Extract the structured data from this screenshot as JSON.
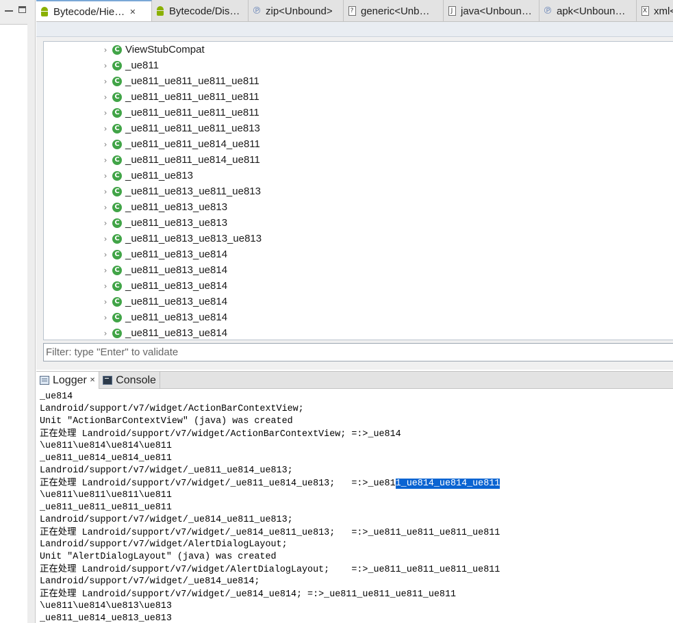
{
  "editor_tabs": [
    {
      "label": "Bytecode/Hie…",
      "icon": "android-icon",
      "active": true,
      "closable": true
    },
    {
      "label": "Bytecode/Dis…",
      "icon": "android-icon",
      "active": false,
      "closable": false
    },
    {
      "label": "zip<Unbound>",
      "icon": "p-icon",
      "active": false,
      "closable": false
    },
    {
      "label": "generic<Unb…",
      "icon": "doc-question-icon",
      "active": false,
      "closable": false
    },
    {
      "label": "java<Unboun…",
      "icon": "doc-j-icon",
      "active": false,
      "closable": false
    },
    {
      "label": "apk<Unboun…",
      "icon": "p-icon",
      "active": false,
      "closable": false
    },
    {
      "label": "xml<",
      "icon": "doc-x-icon",
      "active": false,
      "closable": false
    }
  ],
  "tree_items": [
    "ViewStubCompat",
    "_ue811",
    "_ue811_ue811_ue811_ue811",
    "_ue811_ue811_ue811_ue811",
    "_ue811_ue811_ue811_ue811",
    "_ue811_ue811_ue811_ue813",
    "_ue811_ue811_ue814_ue811",
    "_ue811_ue811_ue814_ue811",
    "_ue811_ue813",
    "_ue811_ue813_ue811_ue813",
    "_ue811_ue813_ue813",
    "_ue811_ue813_ue813",
    "_ue811_ue813_ue813_ue813",
    "_ue811_ue813_ue814",
    "_ue811_ue813_ue814",
    "_ue811_ue813_ue814",
    "_ue811_ue813_ue814",
    "_ue811_ue813_ue814",
    "_ue811_ue813_ue814"
  ],
  "filter": {
    "placeholder": "Filter: type \"Enter\" to validate"
  },
  "log_tabs": [
    {
      "label": "Logger",
      "active": true,
      "closable": true
    },
    {
      "label": "Console",
      "active": false,
      "closable": false
    }
  ],
  "log_lines": [
    {
      "cjk": "",
      "text": "_ue814",
      "sel": ""
    },
    {
      "cjk": "",
      "text": "Landroid/support/v7/widget/ActionBarContextView;",
      "sel": ""
    },
    {
      "cjk": "",
      "text": "Unit \"ActionBarContextView\" (java) was created",
      "sel": ""
    },
    {
      "cjk": "正在处理",
      "text": " Landroid/support/v7/widget/ActionBarContextView; =:>_ue814",
      "sel": ""
    },
    {
      "cjk": "",
      "text": "\\ue811\\ue814\\ue814\\ue811",
      "sel": ""
    },
    {
      "cjk": "",
      "text": "_ue811_ue814_ue814_ue811",
      "sel": ""
    },
    {
      "cjk": "",
      "text": "Landroid/support/v7/widget/_ue811_ue814_ue813;",
      "sel": ""
    },
    {
      "cjk": "正在处理",
      "text": " Landroid/support/v7/widget/_ue811_ue814_ue813;   =:>_ue81",
      "sel": "1_ue814_ue814_ue811"
    },
    {
      "cjk": "",
      "text": "\\ue811\\ue811\\ue811\\ue811",
      "sel": ""
    },
    {
      "cjk": "",
      "text": "_ue811_ue811_ue811_ue811",
      "sel": ""
    },
    {
      "cjk": "",
      "text": "Landroid/support/v7/widget/_ue814_ue811_ue813;",
      "sel": ""
    },
    {
      "cjk": "正在处理",
      "text": " Landroid/support/v7/widget/_ue814_ue811_ue813;   =:>_ue811_ue811_ue811_ue811",
      "sel": ""
    },
    {
      "cjk": "",
      "text": "Landroid/support/v7/widget/AlertDialogLayout;",
      "sel": ""
    },
    {
      "cjk": "",
      "text": "Unit \"AlertDialogLayout\" (java) was created",
      "sel": ""
    },
    {
      "cjk": "正在处理",
      "text": " Landroid/support/v7/widget/AlertDialogLayout;    =:>_ue811_ue811_ue811_ue811",
      "sel": ""
    },
    {
      "cjk": "",
      "text": "Landroid/support/v7/widget/_ue814_ue814;",
      "sel": ""
    },
    {
      "cjk": "正在处理",
      "text": " Landroid/support/v7/widget/_ue814_ue814; =:>_ue811_ue811_ue811_ue811",
      "sel": ""
    },
    {
      "cjk": "",
      "text": "\\ue811\\ue814\\ue813\\ue813",
      "sel": ""
    },
    {
      "cjk": "",
      "text": "_ue811_ue814_ue813_ue813",
      "sel": ""
    }
  ]
}
